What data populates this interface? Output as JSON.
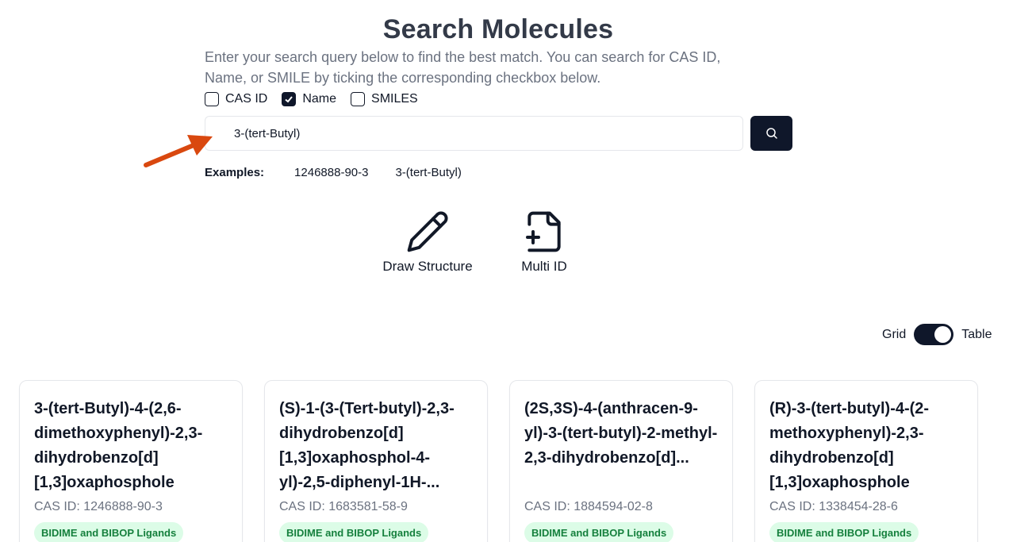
{
  "header": {
    "title": "Search Molecules",
    "subtitle": "Enter your search query below to find the best match. You can search for CAS ID, Name, or SMILE by ticking the corresponding checkbox below."
  },
  "filters": [
    {
      "label": "CAS ID",
      "checked": false
    },
    {
      "label": "Name",
      "checked": true
    },
    {
      "label": "SMILES",
      "checked": false
    }
  ],
  "search": {
    "value": "3-(tert-Butyl)",
    "button_icon": "search-icon"
  },
  "examples": {
    "label": "Examples:",
    "items": [
      "1246888-90-3",
      "3-(tert-Butyl)"
    ]
  },
  "tools": {
    "draw": {
      "label": "Draw Structure",
      "icon": "pencil-icon"
    },
    "multi": {
      "label": "Multi ID",
      "icon": "file-plus-icon"
    }
  },
  "view_toggle": {
    "left_label": "Grid",
    "right_label": "Table",
    "active": "Table"
  },
  "results": [
    {
      "title": "3-(tert-Butyl)-4-(2,6-dimethoxyphenyl)-2,3-dihydrobenzo[d][1,3]oxaphosphole",
      "cas": "CAS ID: 1246888-90-3",
      "tag": "BIDIME and BIBOP Ligands"
    },
    {
      "title": "(S)-1-(3-(Tert-butyl)-2,3-dihydrobenzo[d][1,3]oxaphosphol-4-yl)-2,5-diphenyl-1H-...",
      "cas": "CAS ID: 1683581-58-9",
      "tag": "BIDIME and BIBOP Ligands"
    },
    {
      "title": "(2S,3S)-4-(anthracen-9-yl)-3-(tert-butyl)-2-methyl-2,3-dihydrobenzo[d]...",
      "cas": "CAS ID: 1884594-02-8",
      "tag": "BIDIME and BIBOP Ligands"
    },
    {
      "title": "(R)-3-(tert-butyl)-4-(2-methoxyphenyl)-2,3-dihydrobenzo[d][1,3]oxaphosphole",
      "cas": "CAS ID: 1338454-28-6",
      "tag": "BIDIME and BIBOP Ligands"
    }
  ],
  "colors": {
    "primary": "#0f172a",
    "badge_bg": "#dcfce7",
    "badge_text": "#15803d",
    "annotation_arrow": "#d9480f"
  }
}
